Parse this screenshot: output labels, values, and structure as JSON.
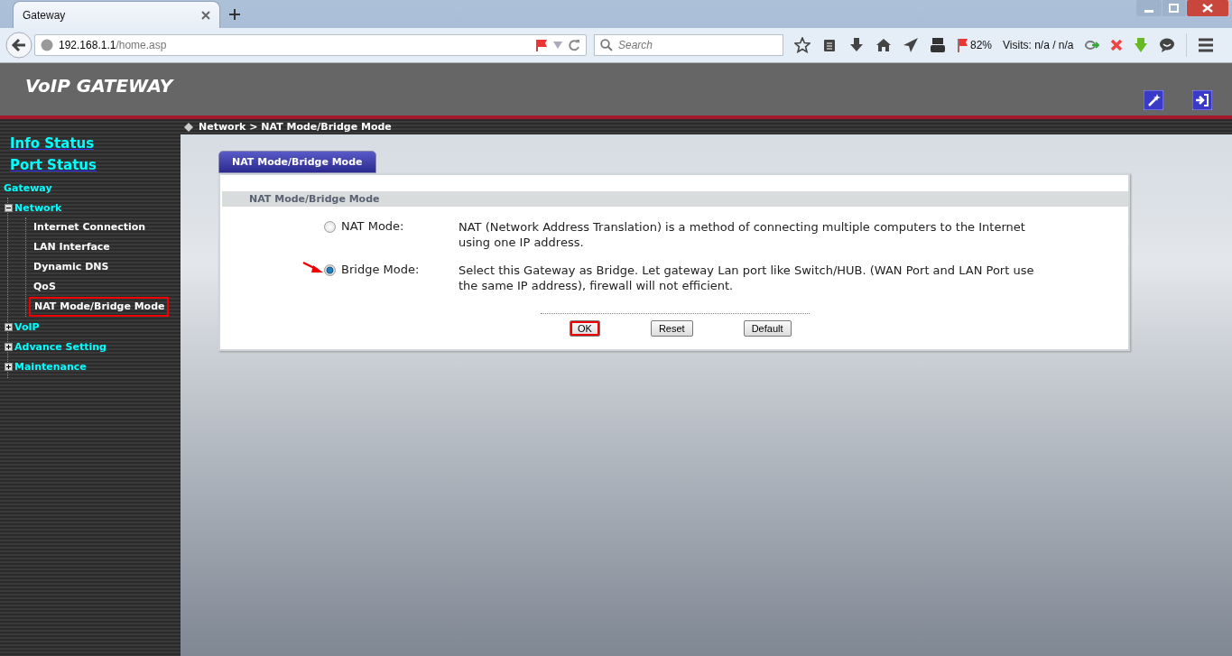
{
  "browser": {
    "tab": {
      "title": "Gateway"
    },
    "address": {
      "host": "192.168.1.1",
      "path": "/home.asp"
    },
    "search": {
      "placeholder": "Search"
    },
    "zoom": "82%",
    "visits": "Visits: n/a / n/a"
  },
  "app": {
    "title": "VoIP GATEWAY",
    "breadcrumb": "Network > NAT Mode/Bridge Mode"
  },
  "sidebar": {
    "links": [
      "Info Status",
      "Port Status"
    ],
    "section": "Gateway",
    "tree": [
      {
        "label": "Network",
        "expanded": true,
        "children": [
          {
            "label": "Internet Connection",
            "selected": false
          },
          {
            "label": "LAN Interface",
            "selected": false
          },
          {
            "label": "Dynamic DNS",
            "selected": false
          },
          {
            "label": "QoS",
            "selected": false
          },
          {
            "label": "NAT Mode/Bridge Mode",
            "selected": true
          }
        ]
      },
      {
        "label": "VoIP",
        "expanded": false
      },
      {
        "label": "Advance Setting",
        "expanded": false
      },
      {
        "label": "Maintenance",
        "expanded": false
      }
    ]
  },
  "panel": {
    "tab_label": "NAT Mode/Bridge Mode",
    "section_title": "NAT Mode/Bridge Mode",
    "options": [
      {
        "label": "NAT Mode:",
        "description": "NAT (Network Address Translation) is a method of connecting multiple computers to the Internet using one IP address.",
        "selected": false,
        "marked": false
      },
      {
        "label": "Bridge Mode:",
        "description": "Select this Gateway as Bridge. Let gateway Lan port like Switch/HUB. (WAN Port and LAN Port use the same IP address), firewall will not efficient.",
        "selected": true,
        "marked": true
      }
    ],
    "buttons": [
      {
        "label": "OK",
        "highlighted": true
      },
      {
        "label": "Reset",
        "highlighted": false
      },
      {
        "label": "Default",
        "highlighted": false
      }
    ]
  }
}
